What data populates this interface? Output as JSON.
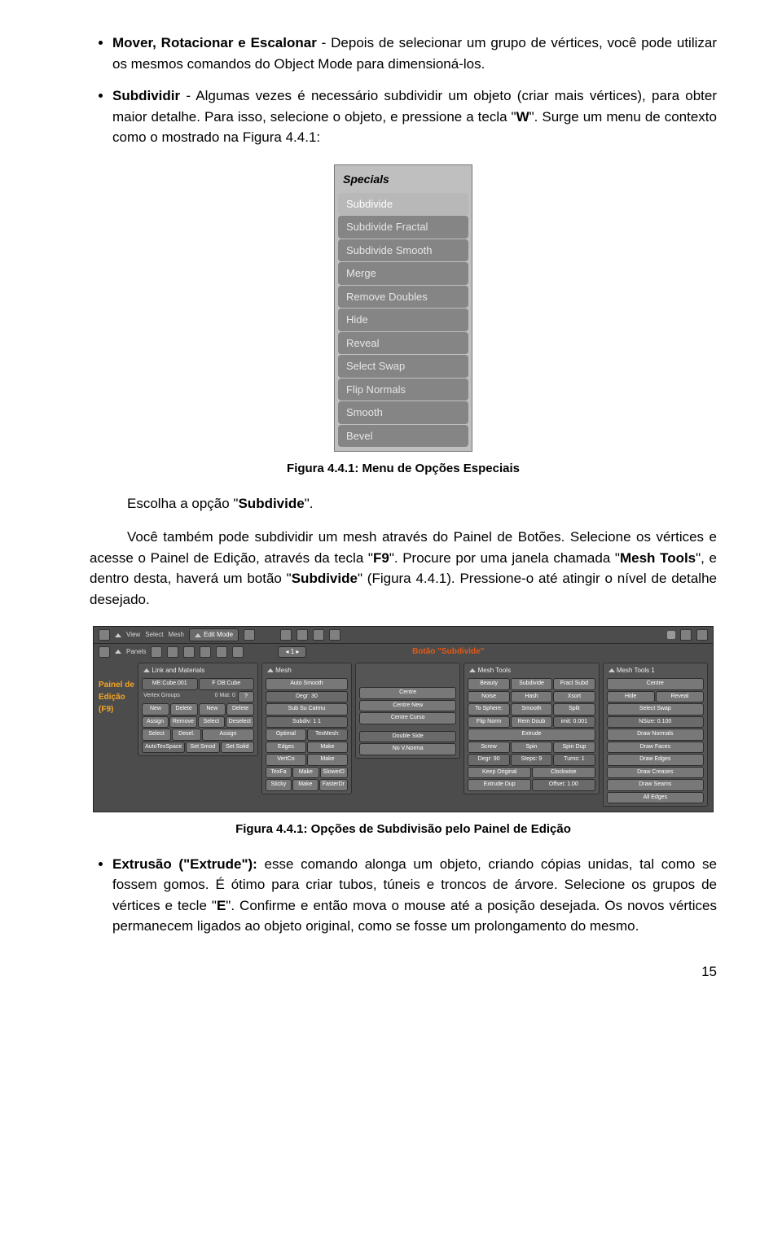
{
  "bullets": {
    "item1_lead": "Mover, Rotacionar e Escalonar",
    "item1_rest": " - Depois de selecionar um grupo de vértices, você pode utilizar os mesmos comandos do Object Mode para dimensioná-los.",
    "item2_lead": "Subdividir",
    "item2_mid": " - Algumas vezes é necessário subdividir um objeto (criar mais vértices), para obter maior detalhe. Para isso, selecione o objeto, e pressione a tecla \"",
    "item2_key": "W",
    "item2_end": "\". Surge um menu de contexto como o mostrado na Figura 4.4.1:"
  },
  "specials": {
    "header": "Specials",
    "items": [
      "Subdivide",
      "Subdivide Fractal",
      "Subdivide Smooth",
      "Merge",
      "Remove Doubles",
      "Hide",
      "Reveal",
      "Select Swap",
      "Flip Normals",
      "Smooth",
      "Bevel"
    ]
  },
  "caption1": "Figura 4.4.1: Menu de Opções Especiais",
  "para1_a": "Escolha a opção \"",
  "para1_b": "Subdivide",
  "para1_c": "\".",
  "para2_a": "Você também pode subdividir um mesh através do Painel de Botões. Selecione os vértices e acesse o Painel de Edição, através da tecla \"",
  "para2_key": "F9",
  "para2_b": "\". Procure por uma janela chamada \"",
  "para2_mesh": "Mesh Tools",
  "para2_c": "\", e dentro desta, haverá um botão \"",
  "para2_sub": "Subdivide",
  "para2_d": "\" (Figura 4.4.1). Pressione-o até atingir o nível de detalhe desejado.",
  "blender": {
    "header1": {
      "view": "View",
      "select": "Select",
      "mesh": "Mesh",
      "mode": "Edit Mode"
    },
    "header2": {
      "panels": "Panels",
      "num": "1"
    },
    "annot_subdivide": "Botão \"Subdivide\"",
    "annot_painel_l1": "Painel de",
    "annot_painel_l2": "Edição",
    "annot_painel_l3": "(F9)",
    "col1": {
      "title": "Link and Materials",
      "me": "ME:Cube.001",
      "ob": "F  OB:Cube",
      "vg": "Vertex Groups",
      "mat": "0 Mat: 0",
      "new": "New",
      "delete": "Delete",
      "new2": "New",
      "delete2": "Delete",
      "assign": "Assign",
      "remove": "Remove",
      "select": "Select",
      "deselect": "Deselect",
      "sel": "Select",
      "desel": "Desel.",
      "assign2": "Assign",
      "ats": "AutoTexSpace",
      "sms": "Set Smod",
      "ss": "Set Solid"
    },
    "col2": {
      "title": "Mesh",
      "as": "Auto Smooth",
      "degr": "Degr: 30",
      "subcat": "Sub Su Catmu",
      "subdiv": "Subdiv: 1  1",
      "opt": "Optimal",
      "texmesh": "TexMesh:",
      "edges": "Edges",
      "make1": "Make",
      "vcol": "VertCo",
      "make2": "Make",
      "texfa": "TexFa",
      "make3": "Make",
      "slow": "SlowerD",
      "sticky": "Sticky",
      "make4": "Make",
      "fast": "FasterDr"
    },
    "col3": {
      "title": "",
      "centre": "Centre",
      "cn": "Centre New",
      "cc": "Centre Curso",
      "ds": "Double Side",
      "nv": "No V.Norma"
    },
    "col4": {
      "title": "Mesh Tools",
      "beauty": "Beauty",
      "subdiv": "Subdivide",
      "fract": "Fract Subd",
      "noise": "Noise",
      "hash": "Hash",
      "xsort": "Xsort",
      "tosphere": "To Sphere:",
      "smooth": "Smooth",
      "split": "Split",
      "flip": "Flip Norm",
      "rem": "Rem Doub",
      "imit": "imit: 0.001",
      "extrude": "Extrude",
      "screw": "Screw",
      "spin": "Spin",
      "spindup": "Spin Dup",
      "degr": "Degr: 90",
      "steps": "Steps: 9",
      "turns": "Turns: 1",
      "keep": "Keep Original",
      "clock": "Clockwise",
      "extdup": "Extrude Dup",
      "offset": "Offset: 1.00"
    },
    "col5": {
      "title": "Mesh Tools 1",
      "centre": "Centre",
      "hide": "Hide",
      "reveal": "Reveal",
      "selswap": "Select Swap",
      "nsize": "NSize: 0.100",
      "dn": "Draw Normals",
      "df": "Draw Faces",
      "de": "Draw Edges",
      "dc": "Draw Creases",
      "ds": "Draw Seams",
      "ae": "All Edges"
    }
  },
  "caption2": "Figura 4.4.1: Opções de Subdivisão pelo Painel de Edição",
  "bullet3": {
    "lead": "Extrusão (\"Extrude\"):",
    "a": " esse comando alonga um objeto, criando cópias unidas, tal como se fossem gomos. É ótimo para criar tubos, túneis e troncos de árvore. Selecione os grupos de vértices e tecle \"",
    "key": "E",
    "b": "\". Confirme e então mova o mouse até a posição desejada. Os novos vértices permanecem ligados ao objeto original, como se fosse um prolongamento do mesmo."
  },
  "page": "15"
}
